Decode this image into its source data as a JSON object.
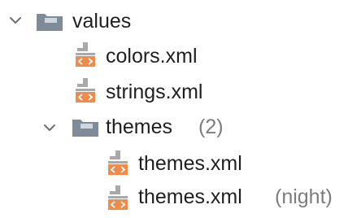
{
  "tree": {
    "values_folder": {
      "label": "values",
      "icon": "folder-icon",
      "expanded": true
    },
    "colors_file": {
      "label": "colors.xml",
      "icon": "xml-file-icon"
    },
    "strings_file": {
      "label": "strings.xml",
      "icon": "xml-file-icon"
    },
    "themes_folder": {
      "label": "themes",
      "count": "(2)",
      "icon": "folder-icon",
      "expanded": true
    },
    "themes_file": {
      "label": "themes.xml",
      "icon": "xml-file-icon"
    },
    "themes_night_file": {
      "label": "themes.xml",
      "qualifier": "(night)",
      "icon": "xml-file-icon"
    }
  },
  "colors": {
    "folder": "#7f8b99",
    "xml_orange": "#f08c4b",
    "xml_grey": "#a9a9a9",
    "chevron": "#6f6f6f",
    "text": "#1f1f1f",
    "muted_text": "#7d7d7d"
  }
}
